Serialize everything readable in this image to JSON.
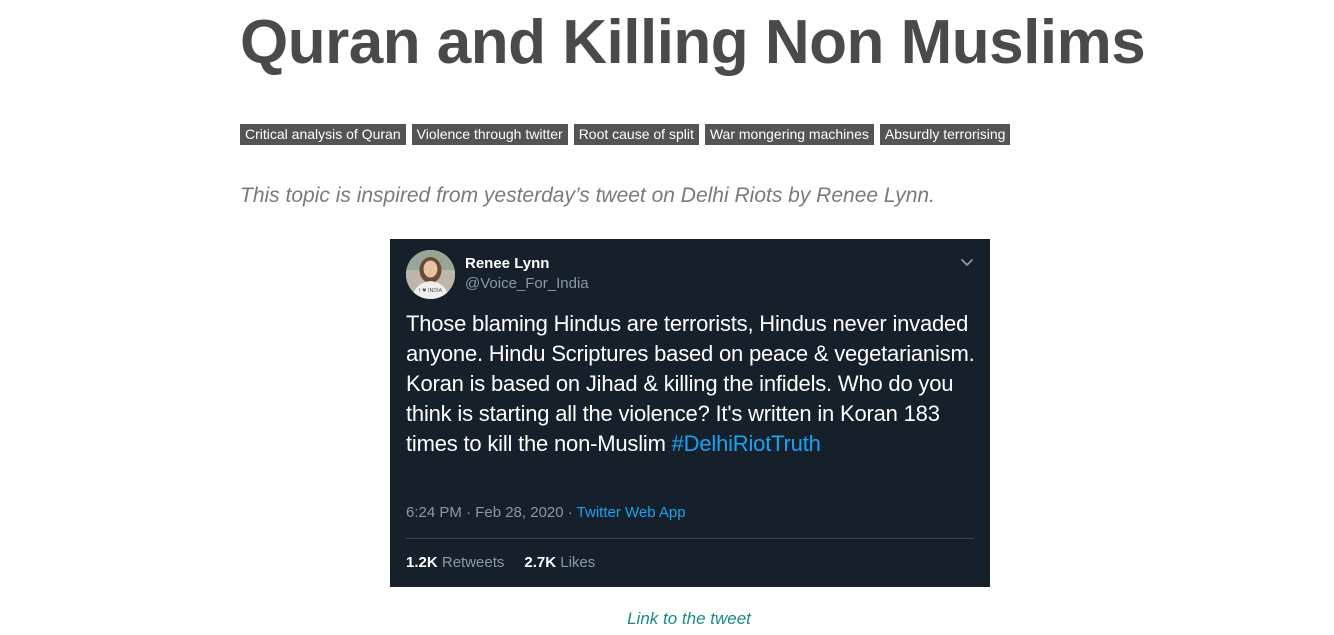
{
  "article": {
    "title": "Quran and Killing Non Muslims",
    "tags": [
      "Critical analysis of Quran",
      "Violence through twitter",
      "Root cause of split",
      "War mongering machines",
      "Absurdly terrorising"
    ],
    "intro": "This topic is inspired from yesterday’s tweet on Delhi Riots by Renee Lynn.",
    "link_label": "Link to the tweet"
  },
  "tweet": {
    "author_name": "Renee Lynn",
    "author_handle": "@Voice_For_India",
    "avatar_caption": "I ♥ INDIA",
    "body": "Those blaming Hindus are terrorists, Hindus never invaded anyone. Hindu Scriptures based on peace & vegetarianism. Koran is based on Jihad & killing the infidels. Who do you think is starting all the violence? It's written in Koran 183 times to kill the non-Muslim ",
    "hashtag": "#DelhiRiotTruth",
    "time": "6:24 PM · Feb 28, 2020 · ",
    "source": "Twitter Web App",
    "retweets_count": "1.2K",
    "retweets_label": "Retweets",
    "likes_count": "2.7K",
    "likes_label": "Likes",
    "icons": {
      "menu": "chevron-down-icon"
    },
    "colors": {
      "background": "#15202b",
      "link": "#1da1f2",
      "secondary_text": "#8899a6"
    }
  },
  "colors": {
    "tag_background": "#545454",
    "link": "#1b8a85"
  }
}
